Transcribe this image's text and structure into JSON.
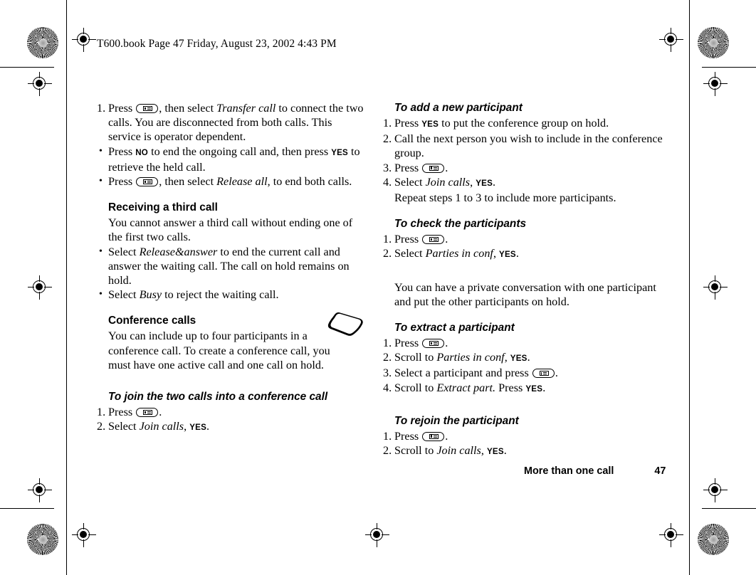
{
  "header": {
    "book_line": "T600.book  Page 47  Friday, August 23, 2002  4:43 PM"
  },
  "footer": {
    "section": "More than one call",
    "page_number": "47"
  },
  "icons": {
    "menu_key": "menu-key-icon",
    "phone_illustration": "phone-illustration-icon"
  },
  "left_column": {
    "step1": {
      "num": "1.",
      "t1": "Press ",
      "t2": ", then select ",
      "em1": "Transfer call",
      "t3": " to connect the two calls. You are disconnected from both calls. This service is operator dependent."
    },
    "bullet1": {
      "mark": "•",
      "t1": "Press ",
      "key1": "NO",
      "t2": " to end the ongoing call and, then press ",
      "key2": "YES",
      "t3": " to retrieve the held call."
    },
    "bullet2": {
      "mark": "•",
      "t1": "Press ",
      "t2": ", then select ",
      "em1": "Release all",
      "t3": ", to end both calls."
    },
    "heading_receiving": "Receiving a third call",
    "para_receiving": "You cannot answer a third call without ending one of the first two calls.",
    "bullet3": {
      "mark": "•",
      "t1": "Select ",
      "em1": "Release&answer",
      "t2": " to end the current call and answer the waiting call. The call on hold remains on hold."
    },
    "bullet4": {
      "mark": "•",
      "t1": "Select ",
      "em1": "Busy",
      "t2": " to reject the waiting call."
    },
    "heading_conference": "Conference calls",
    "para_conference": "You can include up to four participants in a conference call. To create a conference call, you must have one active call and one call on hold.",
    "heading_join": "To join the two calls into a conference call",
    "join_step1": {
      "num": "1.",
      "t1": "Press ",
      "t2": "."
    },
    "join_step2": {
      "num": "2.",
      "t1": "Select ",
      "em1": "Join calls",
      "t2": ", ",
      "key1": "YES",
      "t3": "."
    }
  },
  "right_column": {
    "heading_add": "To add a new participant",
    "add_step1": {
      "num": "1.",
      "t1": "Press ",
      "key1": "YES",
      "t2": " to put the conference group on hold."
    },
    "add_step2": {
      "num": "2.",
      "t1": "Call the next person you wish to include in the conference group."
    },
    "add_step3": {
      "num": "3.",
      "t1": "Press ",
      "t2": "."
    },
    "add_step4": {
      "num": "4.",
      "t1": "Select ",
      "em1": "Join calls",
      "t2": ", ",
      "key1": "YES",
      "t3": "."
    },
    "add_repeat": "Repeat steps 1 to 3 to include more participants.",
    "heading_check": "To check the participants",
    "check_step1": {
      "num": "1.",
      "t1": "Press ",
      "t2": "."
    },
    "check_step2": {
      "num": "2.",
      "t1": "Select ",
      "em1": "Parties in conf",
      "t2": ", ",
      "key1": "YES",
      "t3": "."
    },
    "para_private": "You can have a private conversation with one participant and put the other participants on hold.",
    "heading_extract": "To extract a participant",
    "ext_step1": {
      "num": "1.",
      "t1": "Press ",
      "t2": "."
    },
    "ext_step2": {
      "num": "2.",
      "t1": "Scroll to ",
      "em1": "Parties in conf",
      "t2": ", ",
      "key1": "YES",
      "t3": "."
    },
    "ext_step3": {
      "num": "3.",
      "t1": "Select a participant and press ",
      "t2": "."
    },
    "ext_step4": {
      "num": "4.",
      "t1": "Scroll to ",
      "em1": "Extract part.",
      "t2": " Press ",
      "key1": "YES",
      "t3": "."
    },
    "heading_rejoin": "To rejoin the participant",
    "rej_step1": {
      "num": "1.",
      "t1": "Press ",
      "t2": "."
    },
    "rej_step2": {
      "num": "2.",
      "t1": "Scroll to ",
      "em1": "Join calls",
      "t2": ", ",
      "key1": "YES",
      "t3": "."
    }
  }
}
